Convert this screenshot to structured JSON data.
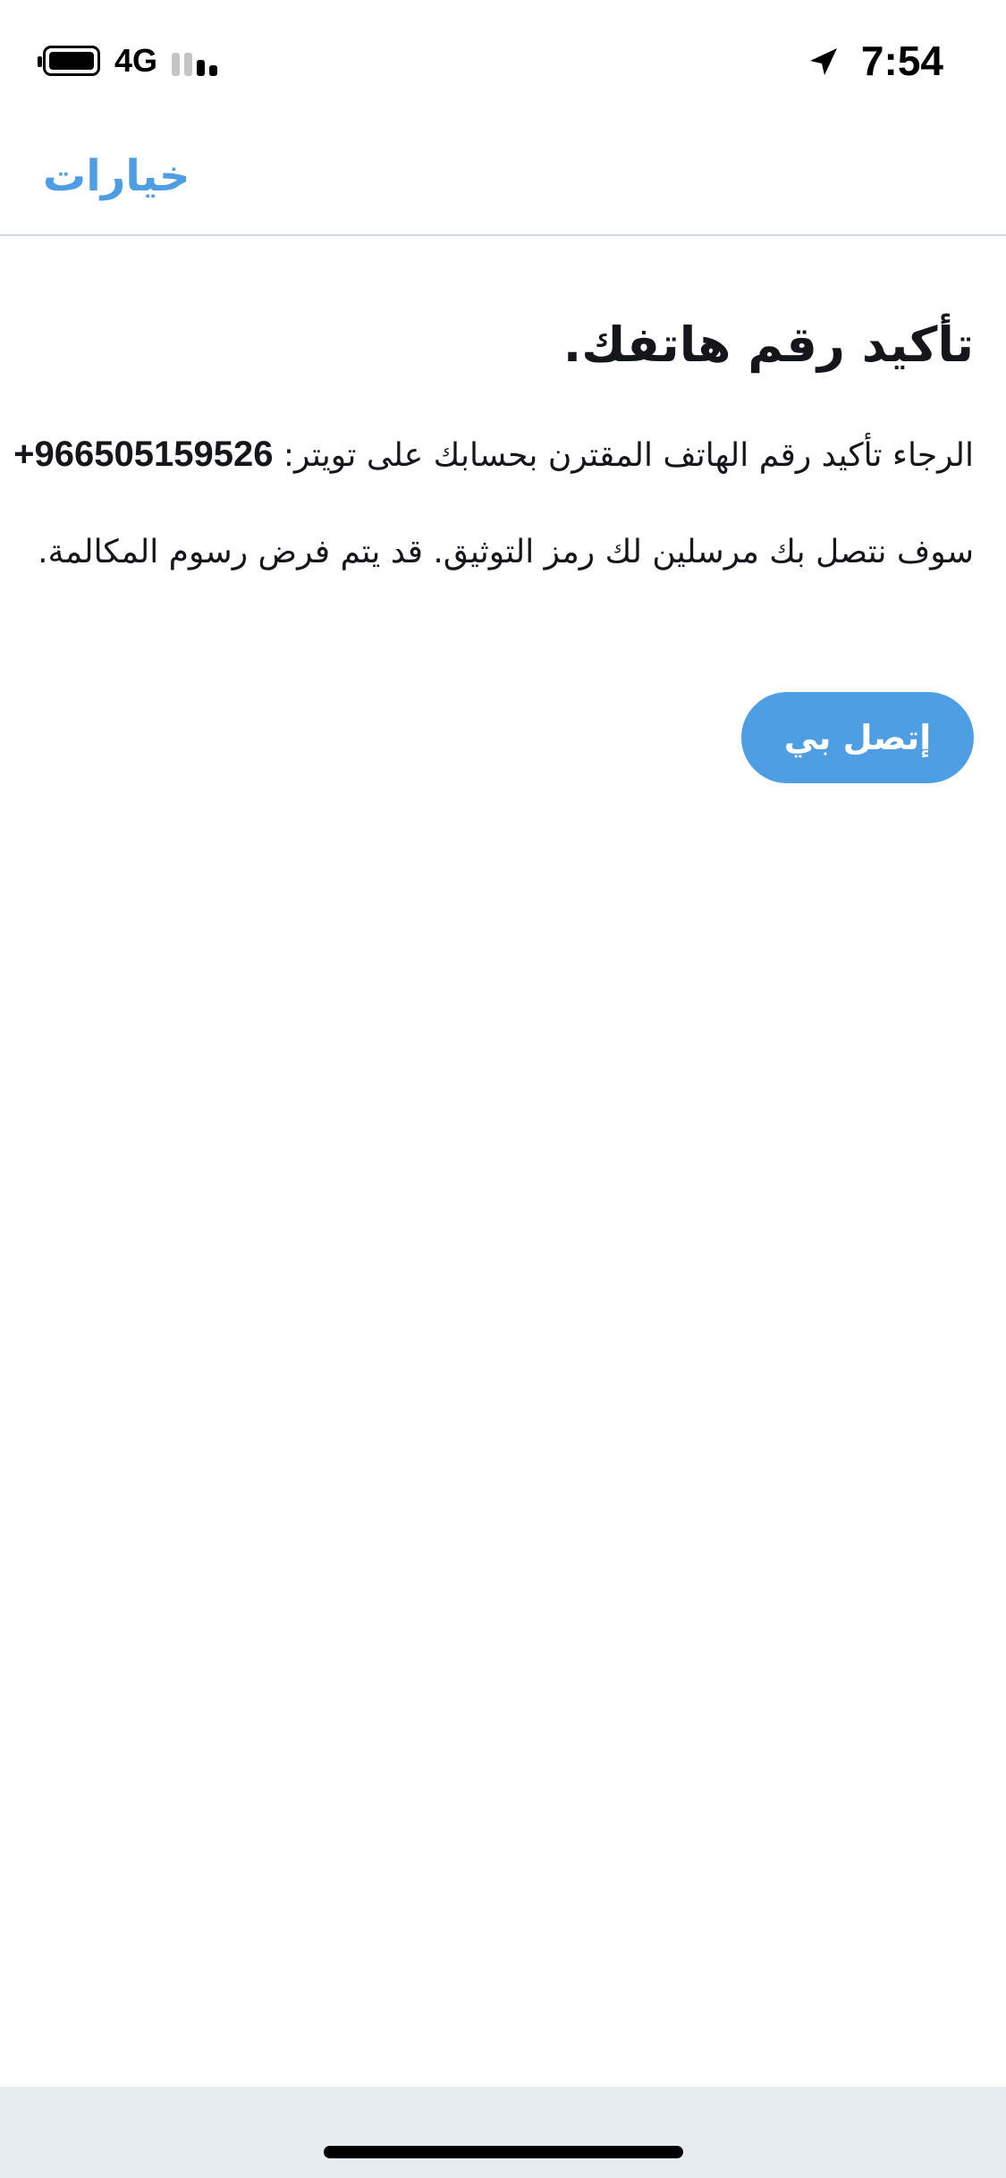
{
  "status_bar": {
    "network": "4G",
    "time": "7:54",
    "battery_icon": "battery-full-icon",
    "signal_icon": "signal-strength-icon",
    "location_icon": "location-arrow-icon",
    "signal_bars_active": 2,
    "signal_bars_total": 4
  },
  "nav": {
    "options_label": "خيارات"
  },
  "main": {
    "title": "تأكيد رقم هاتفك.",
    "instruction": "الرجاء تأكيد رقم الهاتف المقترن بحسابك على تويتر: ",
    "phone_number": "+966505159526",
    "charges_notice": "سوف نتصل بك مرسلين لك رمز التوثيق. قد يتم فرض رسوم المكالمة.",
    "call_me_label": "إتصل بي"
  },
  "colors": {
    "accent": "#4d9ee3",
    "text": "#14171a",
    "divider": "#d6dbe0",
    "home_area": "#e6ecf0"
  }
}
